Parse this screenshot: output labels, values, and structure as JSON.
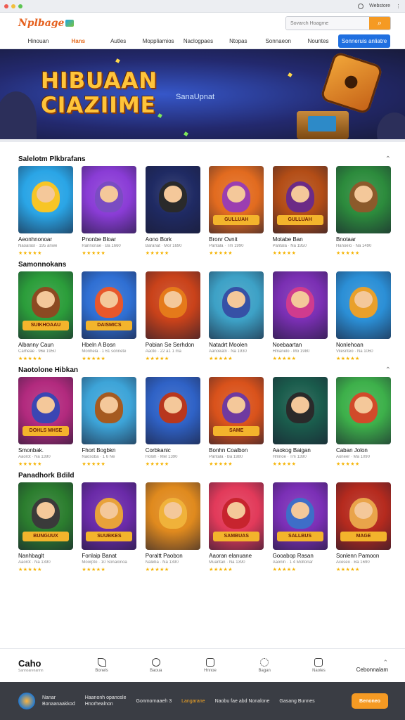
{
  "browser": {
    "title": "Webstore"
  },
  "header": {
    "logo_text": "Nplbage",
    "search_placeholder": "Sovarch Hoagme"
  },
  "nav": {
    "items": [
      "Hinouan",
      "Hans",
      "Autles",
      "Moppliamios",
      "Naclogpaes",
      "Ntopas",
      "Sonnaeon",
      "Nountes"
    ],
    "active_index": 1,
    "cta_label": "Sonneruis anliatre"
  },
  "hero": {
    "title_line1": "HIBUAAN",
    "title_line2": "CIAZIIME",
    "subtitle": "SanaUpnat"
  },
  "sections": [
    {
      "title": "Salelotm Plkbrafans",
      "cards": [
        {
          "title": "Aeonhnonoar",
          "meta": "Naoarasl · 195 anwe",
          "stars": "★★★★★",
          "bg": "#2aa5e6",
          "fig": "#f7c526",
          "band": ""
        },
        {
          "title": "Pnonbe Bloar",
          "meta": "Rannonae · Ba 1660",
          "stars": "★★★★★",
          "bg": "#8a3cd6",
          "fig": "#7a4cc2",
          "band": ""
        },
        {
          "title": "Aono Bork",
          "meta": "Baranat · Mor 1690",
          "stars": "★★★★★",
          "bg": "#1f2a63",
          "fig": "#2a2a2a",
          "band": ""
        },
        {
          "title": "Bronr Ovnit",
          "meta": "Pantala · Tm 1990",
          "stars": "★★★★★",
          "bg": "#e26b1f",
          "fig": "#9b3eb0",
          "band": "GULLUAH"
        },
        {
          "title": "Motabe Ban",
          "meta": "Pantala · Na 1950",
          "stars": "★★★★★",
          "bg": "#b34d16",
          "fig": "#6c2b86",
          "band": "GULLUAH"
        },
        {
          "title": "Bnotaar",
          "meta": "Hanoelo · Na 1490",
          "stars": "★★★★★",
          "bg": "#2c8b3c",
          "fig": "#8c5a2b",
          "band": ""
        }
      ]
    },
    {
      "title": "Samonnokans",
      "cards": [
        {
          "title": "Albanny Caun",
          "meta": "Carheae · 96e 1950",
          "stars": "★★★★★",
          "bg": "#2b9d3a",
          "fig": "#8c4a22",
          "band": "SUIKHOAAU"
        },
        {
          "title": "Hbeln A Bosn",
          "meta": "Monhela · 1 61 sonnete",
          "stars": "★★★★★",
          "bg": "#2f6fd3",
          "fig": "#e8572b",
          "band": "DAISMICS"
        },
        {
          "title": "Pobian Se Serhdon",
          "meta": "Aaoto · 22 a1 1 ma",
          "stars": "★★★★★",
          "bg": "#c9421a",
          "fig": "#e57a1a",
          "band": ""
        },
        {
          "title": "Natadrt Moolen",
          "meta": "Aanoeatn · Na 1930",
          "stars": "★★★★★",
          "bg": "#3da1c6",
          "fig": "#3651a6",
          "band": ""
        },
        {
          "title": "Noebaartan",
          "meta": "Hmanelo · Mo 1980",
          "stars": "★★★★★",
          "bg": "#7a2fb3",
          "fig": "#d03b8e",
          "band": ""
        },
        {
          "title": "Nonlehoan",
          "meta": "Vilesnteo · Na 1060",
          "stars": "★★★★★",
          "bg": "#2b8fd6",
          "fig": "#e9a02b",
          "band": ""
        }
      ]
    },
    {
      "title": "Naotolone Hibkan",
      "cards": [
        {
          "title": "Smonbak.",
          "meta": "Aaorot · Na 1390",
          "stars": "★★★★★",
          "bg": "#b22a7e",
          "fig": "#3b46b3",
          "band": "DOHLS MHSE"
        },
        {
          "title": "Fhort Bogbkn",
          "meta": "Naosoba · 1 6 Ne",
          "stars": "★★★★★",
          "bg": "#3da4d8",
          "fig": "#a55a20",
          "band": ""
        },
        {
          "title": "Corbkanic",
          "meta": "Holoh · Mel 1390",
          "stars": "★★★★★",
          "bg": "#2f62c6",
          "fig": "#b8371e",
          "band": ""
        },
        {
          "title": "Bonhn Coalbon",
          "meta": "Pantala · Ba 1980",
          "stars": "★★★★★",
          "bg": "#d9521b",
          "fig": "#6f3aa0",
          "band": "SAME"
        },
        {
          "title": "Aaokog Baigan",
          "meta": "Hmnoe · Tm 1390",
          "stars": "★★★★★",
          "bg": "#1a5c4c",
          "fig": "#2a2a2a",
          "band": ""
        },
        {
          "title": "Caban Jolon",
          "meta": "Aoneer · Ma 1090",
          "stars": "★★★★★",
          "bg": "#3db04a",
          "fig": "#d14a2a",
          "band": ""
        }
      ]
    },
    {
      "title": "Panadhork Bdild",
      "cards": [
        {
          "title": "Nanhbaglt",
          "meta": "Aaorot · Na 1390",
          "stars": "★★★★★",
          "bg": "#2b7d2e",
          "fig": "#3a3a3a",
          "band": "BUNGUUX"
        },
        {
          "title": "Fonlaip Banat",
          "meta": "Moorpto · 10 Sonalonoa",
          "stars": "★★★★★",
          "bg": "#6a2aa8",
          "fig": "#e8a23a",
          "band": "SUUBKES"
        },
        {
          "title": "Poraltt Paobon",
          "meta": "Naleba · Na 1390",
          "stars": "★★★★★",
          "bg": "#e08a1e",
          "fig": "#f0b23a",
          "band": ""
        },
        {
          "title": "Aaoran elanuane",
          "meta": "Muantan · Na 1390",
          "stars": "★★★★★",
          "bg": "#e23a5a",
          "fig": "#c7242e",
          "band": "SAMBUAS"
        },
        {
          "title": "Gooabop Rasan",
          "meta": "Aaonln · 1 4 Moltonar",
          "stars": "★★★★★",
          "bg": "#7b2fb6",
          "fig": "#3e6ec8",
          "band": "SALLBUS"
        },
        {
          "title": "Sonlenn Pamoon",
          "meta": "Aceseo · Ba 1690",
          "stars": "★★★★★",
          "bg": "#b52a1e",
          "fig": "#e9a44a",
          "band": "MAGE"
        }
      ]
    }
  ],
  "bottom_bar": {
    "brand": "Caho",
    "brand_sub": "Sannoarenannn",
    "tabs": [
      "Bonels",
      "Baoua",
      "Hnnoe",
      "Bagan",
      "Naoles"
    ],
    "right_label": "Cebonnalam"
  },
  "footer": {
    "brand_line1": "Nanar",
    "brand_line2": "Bonaanaakkod",
    "link1_line1": "Haanonh opanosle",
    "link1_line2": "Hnorhealnon",
    "link2": "Gonmornaaeh 3",
    "link3": "Langarane",
    "link4": "Naobu fae abd Nonalone",
    "link5": "Gasang Bunnes",
    "button_label": "Benoneo"
  },
  "colors": {
    "accent": "#f59a23",
    "primary": "#1f6fe0",
    "star": "#f5b302"
  }
}
